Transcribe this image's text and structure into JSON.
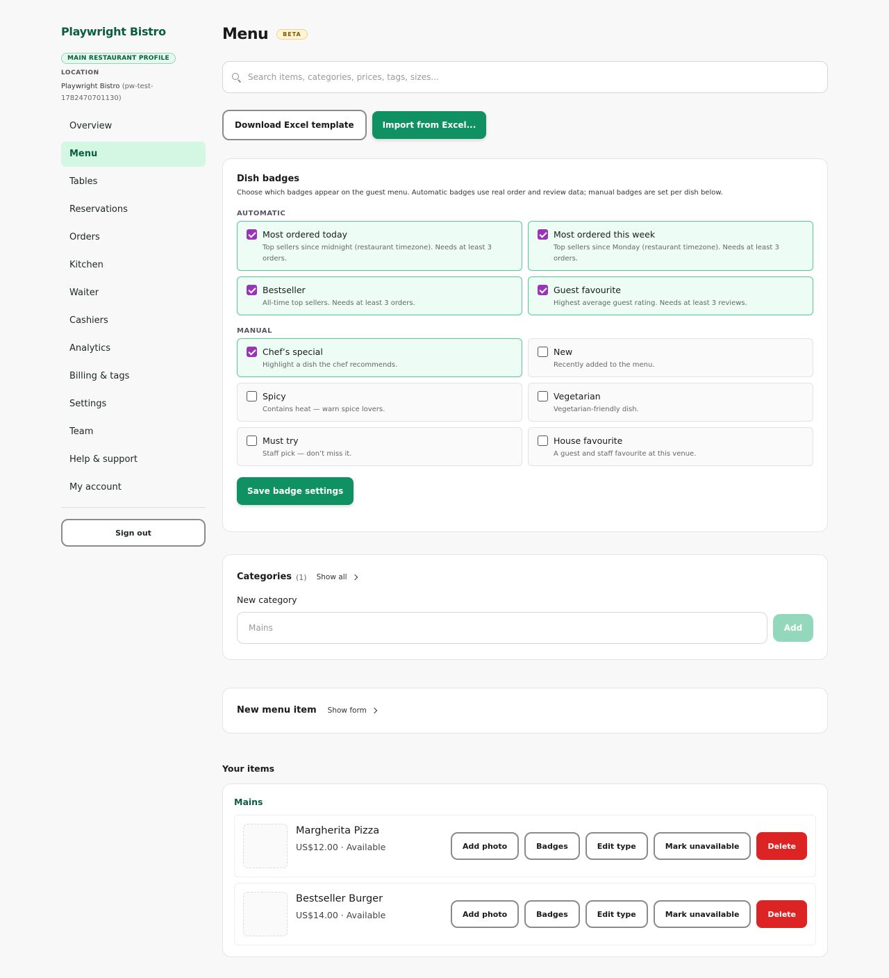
{
  "sidebar": {
    "brand": "Playwright Bistro",
    "profile_badge": "MAIN RESTAURANT PROFILE",
    "location_label": "LOCATION",
    "location_name": "Playwright Bistro",
    "location_id": "(pw-test-1782470701130)",
    "items": [
      {
        "label": "Overview"
      },
      {
        "label": "Menu"
      },
      {
        "label": "Tables"
      },
      {
        "label": "Reservations"
      },
      {
        "label": "Orders"
      },
      {
        "label": "Kitchen"
      },
      {
        "label": "Waiter"
      },
      {
        "label": "Cashiers"
      },
      {
        "label": "Analytics"
      },
      {
        "label": "Billing & tags"
      },
      {
        "label": "Settings"
      },
      {
        "label": "Team"
      },
      {
        "label": "Help & support"
      },
      {
        "label": "My account"
      }
    ],
    "active_item": "Menu",
    "sign_out": "Sign out"
  },
  "header": {
    "title": "Menu",
    "badge": "BETA"
  },
  "search": {
    "placeholder": "Search items, categories, prices, tags, sizes..."
  },
  "actions": {
    "download": "Download Excel template",
    "import": "Import from Excel..."
  },
  "badges": {
    "title": "Dish badges",
    "description": "Choose which badges appear on the guest menu. Automatic badges use real order and review data; manual badges are set per dish below.",
    "automatic_label": "AUTOMATIC",
    "automatic": [
      {
        "title": "Most ordered today",
        "desc": "Top sellers since midnight (restaurant timezone). Needs at least 3 orders.",
        "checked": true
      },
      {
        "title": "Most ordered this week",
        "desc": "Top sellers since Monday (restaurant timezone). Needs at least 3 orders.",
        "checked": true
      },
      {
        "title": "Bestseller",
        "desc": "All-time top sellers. Needs at least 3 orders.",
        "checked": true
      },
      {
        "title": "Guest favourite",
        "desc": "Highest average guest rating. Needs at least 3 reviews.",
        "checked": true
      }
    ],
    "manual_label": "MANUAL",
    "manual": [
      {
        "title": "Chef’s special",
        "desc": "Highlight a dish the chef recommends.",
        "checked": true
      },
      {
        "title": "New",
        "desc": "Recently added to the menu.",
        "checked": false
      },
      {
        "title": "Spicy",
        "desc": "Contains heat — warn spice lovers.",
        "checked": false
      },
      {
        "title": "Vegetarian",
        "desc": "Vegetarian-friendly dish.",
        "checked": false
      },
      {
        "title": "Must try",
        "desc": "Staff pick — don’t miss it.",
        "checked": false
      },
      {
        "title": "House favourite",
        "desc": "A guest and staff favourite at this venue.",
        "checked": false
      }
    ],
    "save": "Save badge settings"
  },
  "categories": {
    "title": "Categories",
    "count": "(1)",
    "show_all": "Show all",
    "new_label": "New category",
    "placeholder": "Mains",
    "add": "Add"
  },
  "new_item": {
    "title": "New menu item",
    "show_form": "Show form"
  },
  "items": {
    "heading": "Your items",
    "category": "Mains",
    "list": [
      {
        "name": "Margherita Pizza",
        "meta": "US$12.00 · Available"
      },
      {
        "name": "Bestseller Burger",
        "meta": "US$14.00 · Available"
      }
    ],
    "buttons": {
      "add_photo": "Add photo",
      "badges": "Badges",
      "edit_type": "Edit type",
      "mark_unavailable": "Mark unavailable",
      "delete": "Delete"
    }
  },
  "colors": {
    "brand": "#0b5d3f",
    "primary": "#0f9163",
    "checkbox": "#9a34b8",
    "danger": "#dc2424",
    "active_nav_bg": "#d4f7e3"
  }
}
